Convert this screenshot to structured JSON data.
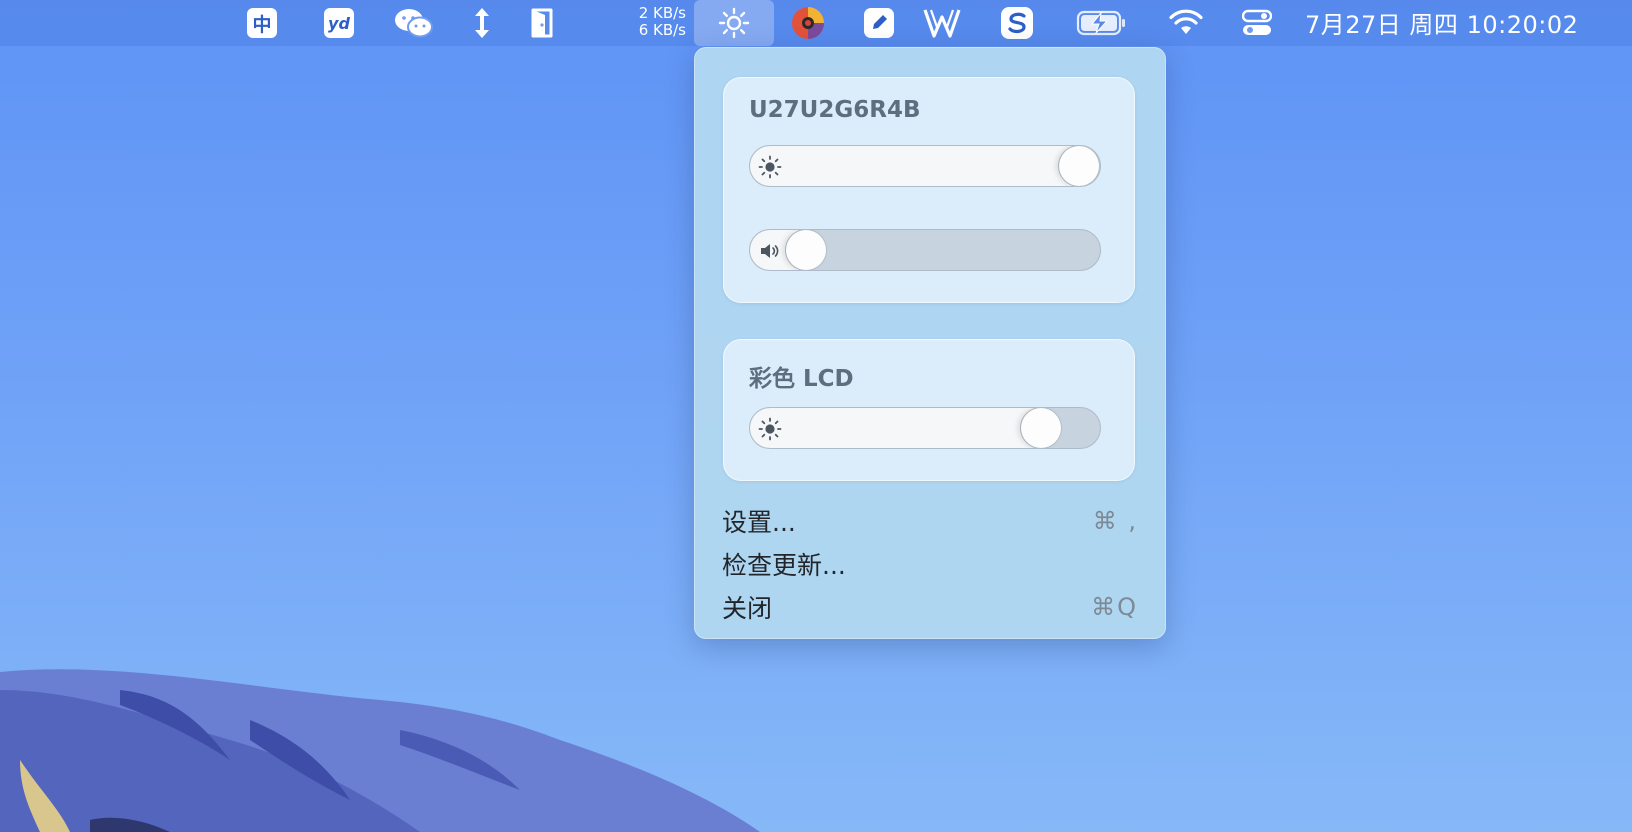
{
  "menubar": {
    "icons": [
      "input-method-icon",
      "youdao-icon",
      "wechat-icon",
      "arrows-updown-icon",
      "door-icon",
      "netspeed",
      "brightness-icon",
      "color-app-icon",
      "pencil-icon",
      "vector-w-icon",
      "s-app-icon",
      "battery-charging-icon",
      "wifi-icon",
      "control-center-icon"
    ],
    "input_method_label": "中",
    "youdao_label": "yd",
    "net_up": "2 KB/s",
    "net_down": "6 KB/s",
    "clock": "7月27日 周四  10:20:02"
  },
  "popup": {
    "display1": {
      "title": "U27U2G6R4B",
      "brightness_level": 0.94,
      "volume_level": 0.16
    },
    "display2": {
      "title": "彩色 LCD",
      "brightness_level": 0.83
    },
    "menu": [
      {
        "label": "设置...",
        "shortcut": "⌘ ,"
      },
      {
        "label": "检查更新...",
        "shortcut": ""
      },
      {
        "label": "关闭",
        "shortcut": "⌘Q"
      }
    ]
  },
  "colors": {
    "desktop_top": "#5f93f6",
    "desktop_bottom": "#86b8f8",
    "popup_bg": "#b2d8f0",
    "slider_track": "#c7d3df",
    "slider_fill": "#f5f7f9"
  }
}
